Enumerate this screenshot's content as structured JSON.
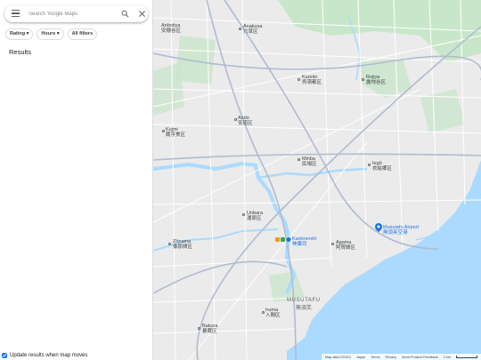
{
  "search": {
    "placeholder": "Search Yoogle Maps"
  },
  "filters": [
    {
      "label": "Rating ▾"
    },
    {
      "label": "Hours ▾"
    },
    {
      "label": "All filters"
    }
  ],
  "results": {
    "title": "Results"
  },
  "update_checkbox": {
    "label": "Update results when map moves",
    "checked": true
  },
  "map": {
    "places": [
      {
        "name": "Anbotiya",
        "native": "安穂谷区"
      },
      {
        "name": "Anakusa",
        "native": "穴草区"
      },
      {
        "name": "Kureito",
        "native": "呉嶺都区"
      },
      {
        "name": "Rojiya",
        "native": "露地谷区"
      },
      {
        "name": "Ando",
        "native": "安道区"
      },
      {
        "name": "Kujmi",
        "native": "蔵亨美区"
      },
      {
        "name": "Minba",
        "native": "民場区"
      },
      {
        "name": "Iegō",
        "native": "衣絵郷区"
      },
      {
        "name": "Unbara",
        "native": "運原区"
      },
      {
        "name": "Zōnama",
        "native": "像那間区"
      },
      {
        "name": "Agama",
        "native": "阿賀間区"
      },
      {
        "name": "Iruma",
        "native": "入間区"
      },
      {
        "name": "Bakura",
        "native": "暴蔵区"
      }
    ],
    "city": {
      "name": "MUSUTAFU",
      "native": "無須芙"
    },
    "airport": {
      "name": "Musutafu Airport",
      "native": "無須芙空港"
    },
    "station": {
      "name": "Kamirenshi",
      "native": "神廉司"
    },
    "attribution": [
      "Map data ©20XX",
      "Japan",
      "Terms",
      "Privacy",
      "Send Product Feedback",
      "2 km"
    ],
    "colors": {
      "water": "#aadaff",
      "park": "#c8e6c9",
      "land": "#ebebeb",
      "road": "#ffffff",
      "highway": "#b0bcd0"
    }
  }
}
